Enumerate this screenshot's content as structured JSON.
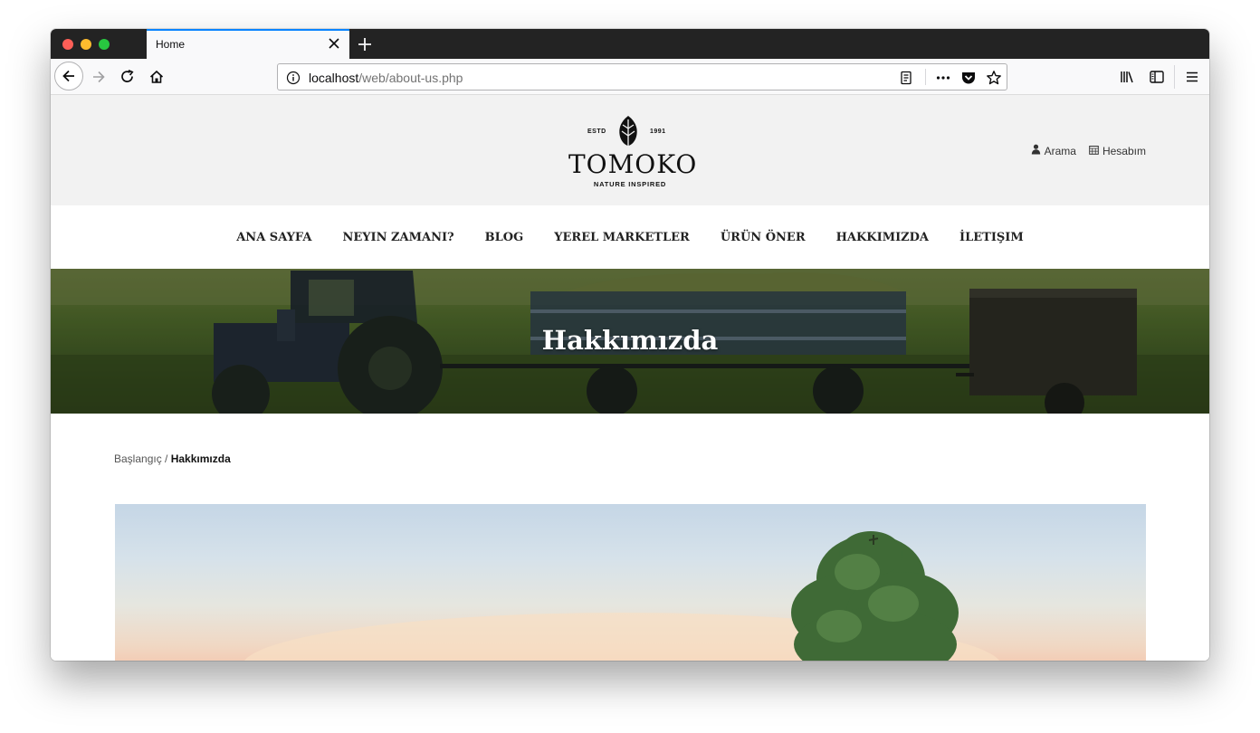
{
  "browser": {
    "tab_title": "Home",
    "url_host": "localhost",
    "url_path": "/web/about-us.php",
    "icons": [
      "back-icon",
      "forward-icon",
      "reload-icon",
      "home-icon",
      "info-icon",
      "reader-view-icon",
      "more-icon",
      "pocket-icon",
      "bookmark-star-icon",
      "library-icon",
      "sidebar-icon",
      "menu-icon"
    ]
  },
  "site": {
    "logo": {
      "estd": "ESTD",
      "year": "1991",
      "brand": "TOMOKO",
      "tagline": "NATURE INSPIRED"
    },
    "header_links": {
      "search": "Arama",
      "account": "Hesabım"
    },
    "menu": [
      {
        "label": "ANA SAYFA"
      },
      {
        "label": "NEYIN ZAMANI?"
      },
      {
        "label": "BLOG"
      },
      {
        "label": "YEREL MARKETLER"
      },
      {
        "label": "ÜRÜN ÖNER"
      },
      {
        "label": "HAKKIMIZDA"
      },
      {
        "label": "İLETIŞIM"
      }
    ],
    "hero_title": "Hakkımızda",
    "breadcrumb": {
      "home": "Başlangıç",
      "sep": " / ",
      "current": "Hakkımızda"
    }
  }
}
